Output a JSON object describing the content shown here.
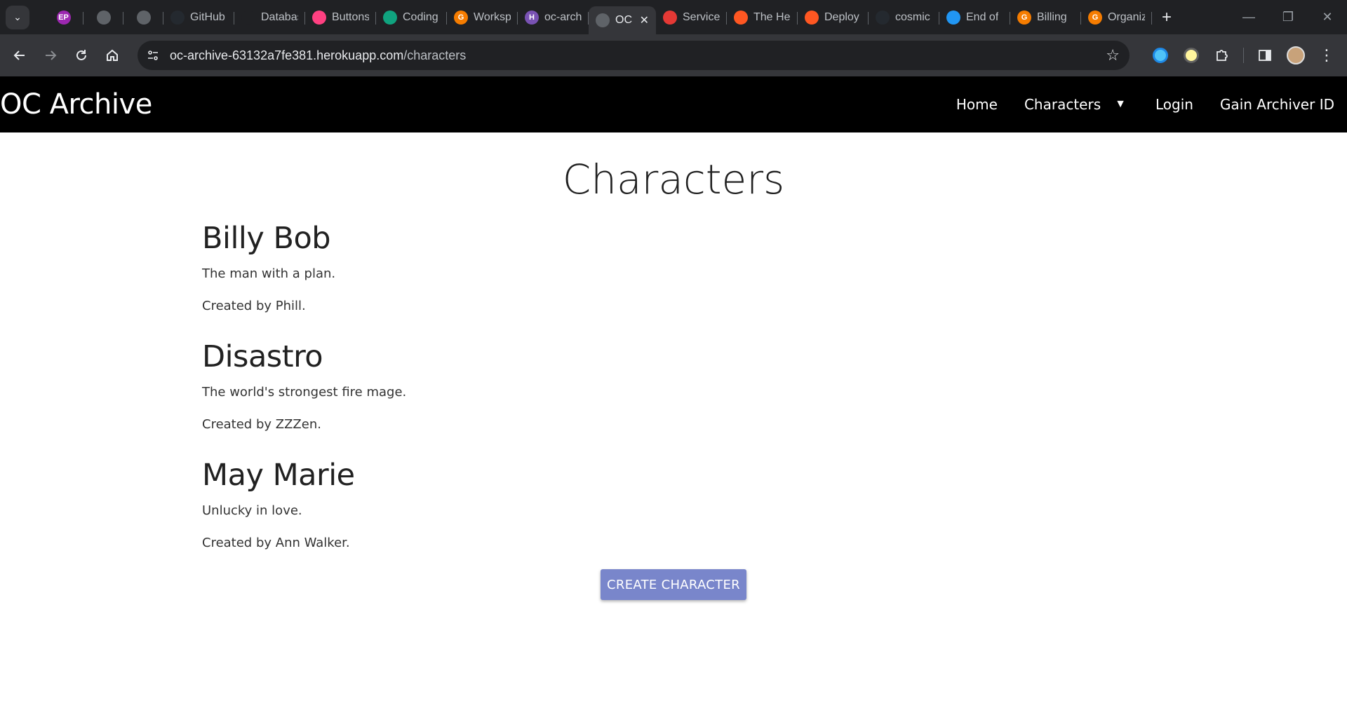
{
  "browser": {
    "tabs": [
      {
        "title": "",
        "favicon": "EP",
        "color": "#9c27b0",
        "icon_only": true
      },
      {
        "title": "",
        "favicon": "globe",
        "color": "#5f6368",
        "icon_only": true
      },
      {
        "title": "",
        "favicon": "globe",
        "color": "#5f6368",
        "icon_only": true
      },
      {
        "title": "GitHub",
        "favicon": "github",
        "color": "#24292f"
      },
      {
        "title": "Database",
        "favicon": "git",
        "color": "#202124"
      },
      {
        "title": "Buttons",
        "favicon": "m",
        "color": "#ff4081"
      },
      {
        "title": "Coding",
        "favicon": "openai",
        "color": "#10a37f"
      },
      {
        "title": "Workspace",
        "favicon": "G",
        "color": "#f57c00"
      },
      {
        "title": "oc-archive",
        "favicon": "H",
        "color": "#7952b3"
      },
      {
        "title": "OC",
        "favicon": "globe",
        "color": "#5f6368",
        "active": true
      },
      {
        "title": "Services",
        "favicon": "crab",
        "color": "#e53935"
      },
      {
        "title": "The Heroku",
        "favicon": "ring",
        "color": "#ff5722"
      },
      {
        "title": "Deploy",
        "favicon": "ring",
        "color": "#ff5722"
      },
      {
        "title": "cosmic",
        "favicon": "github",
        "color": "#24292f"
      },
      {
        "title": "End of",
        "favicon": "hat",
        "color": "#2196f3"
      },
      {
        "title": "Billing",
        "favicon": "G",
        "color": "#f57c00"
      },
      {
        "title": "Organization",
        "favicon": "G",
        "color": "#f57c00"
      }
    ],
    "url_host": "oc-archive-63132a7fe381.herokuapp.com",
    "url_path": "/characters"
  },
  "site": {
    "brand": "OC Archive",
    "nav": {
      "home": "Home",
      "characters": "Characters",
      "login": "Login",
      "gain_id": "Gain Archiver ID"
    }
  },
  "main": {
    "heading": "Characters",
    "characters": [
      {
        "name": "Billy Bob",
        "description": "The man with a plan.",
        "creator": "Created by Phill."
      },
      {
        "name": "Disastro",
        "description": "The world's strongest fire mage.",
        "creator": "Created by ZZZen."
      },
      {
        "name": "May Marie",
        "description": "Unlucky in love.",
        "creator": "Created by Ann Walker."
      }
    ],
    "create_button": "CREATE CHARACTER"
  }
}
